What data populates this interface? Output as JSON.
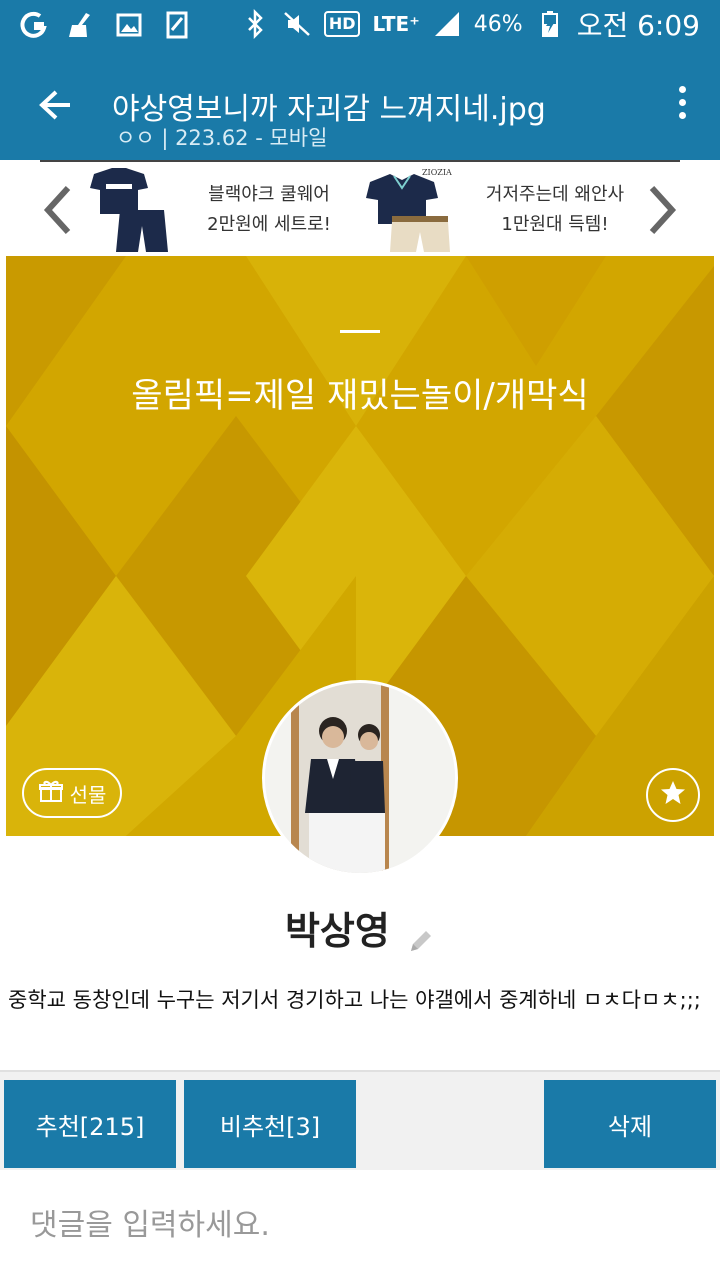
{
  "statusbar": {
    "hd": "HD",
    "lte": "LTE⁺",
    "battery_percent": "46%",
    "time": "오전 6:09",
    "icons": [
      "app-icon",
      "cleaner-icon",
      "gallery-icon",
      "memo-icon",
      "bluetooth-icon",
      "mute-icon",
      "hd-icon",
      "lte-icon",
      "signal-icon",
      "battery-icon"
    ]
  },
  "appbar": {
    "title": "야상영보니까 자괴감 느껴지네.jpg",
    "subtitle": "ㅇㅇ | 223.62 - 모바일"
  },
  "ad": {
    "left_text_line1": "블랙야크 쿨웨어",
    "left_text_line2": "2만원에 세트로!",
    "right_text_line1": "거저주는데 왜안사",
    "right_text_line2": "1만원대 득템!",
    "brand_label": "ZIOZIA"
  },
  "cover": {
    "status_message": "올림픽=제일 재밌는놀이/개막식",
    "gift_label": "선물",
    "colors": {
      "background": "#d4a800",
      "accent": "#c19400"
    }
  },
  "profile": {
    "name": "박상영"
  },
  "post": {
    "body": "중학교 동창인데 누구는 저기서 경기하고 나는 야갤에서 중계하네 ㅁㅊ다ㅁㅊ;;;"
  },
  "actions": {
    "recommend": "추천[215]",
    "not_recommend": "비추천[3]",
    "delete": "삭제"
  },
  "comment": {
    "placeholder": "댓글을 입력하세요."
  },
  "theme": {
    "primary": "#1a7aa8"
  }
}
